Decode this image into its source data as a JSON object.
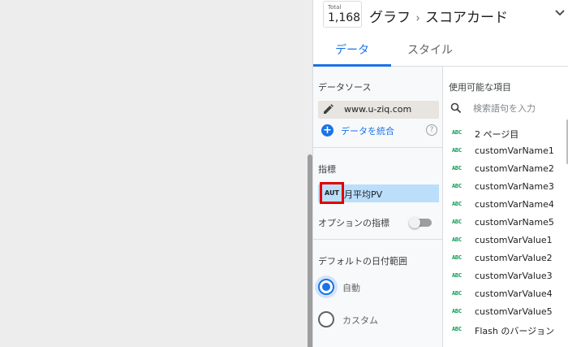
{
  "header": {
    "total_label": "Total",
    "total_value": "1,168",
    "crumb_parent": "グラフ",
    "crumb_separator": "›",
    "crumb_current": "スコアカード"
  },
  "tabs": [
    {
      "label": "データ",
      "active": true
    },
    {
      "label": "スタイル",
      "active": false
    }
  ],
  "data_source": {
    "title": "データソース",
    "name": "www.u-ziq.com",
    "blend_label": "データを統合",
    "help_glyph": "?"
  },
  "metric": {
    "title": "指標",
    "badge": "AUT",
    "name": "月平均PV",
    "highlight_color": "#e00000"
  },
  "optional_metrics": {
    "label": "オプションの指標",
    "enabled": false
  },
  "date_range": {
    "title": "デフォルトの日付範囲",
    "options": [
      {
        "label": "自動",
        "selected": true
      },
      {
        "label": "カスタム",
        "selected": false
      }
    ]
  },
  "available_fields": {
    "title": "使用可能な項目",
    "search_placeholder": "検索語句を入力",
    "type_badge": "ABC",
    "items": [
      "2 ページ目",
      "customVarName1",
      "customVarName2",
      "customVarName3",
      "customVarName4",
      "customVarName5",
      "customVarValue1",
      "customVarValue2",
      "customVarValue3",
      "customVarValue4",
      "customVarValue5",
      "Flash のバージョン"
    ]
  },
  "colors": {
    "accent": "#1a73e8",
    "field_type": "#0f9d58",
    "metric_bg": "#bbdefb"
  }
}
